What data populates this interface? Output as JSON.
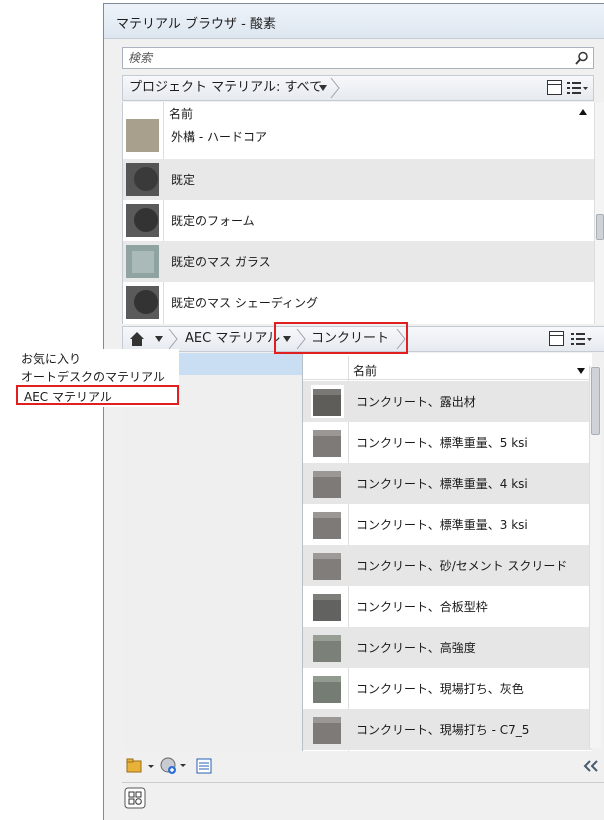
{
  "window": {
    "title": "マテリアル ブラウザ - 酸素"
  },
  "search": {
    "placeholder": "検索"
  },
  "project_bar": {
    "label": "プロジェクト マテリアル: すべて"
  },
  "upper_list": {
    "header": "名前",
    "items": [
      {
        "label": "外構 - ハードコア",
        "swatch": "#a89f8c"
      },
      {
        "label": "既定",
        "swatch": "#4a4a4a"
      },
      {
        "label": "既定のフォーム",
        "swatch": "#3e3e3e"
      },
      {
        "label": "既定のマス ガラス",
        "swatch": "#8fa3a0"
      },
      {
        "label": "既定のマス シェーディング",
        "swatch": "#3e3e3e"
      }
    ]
  },
  "library_bar": {
    "crumb_library": "AEC マテリアル",
    "crumb_category": "コンクリート"
  },
  "library_popup": {
    "items": [
      "お気に入り",
      "オートデスクのマテリアル",
      "AEC マテリアル"
    ],
    "selected_index": 2
  },
  "lower_list": {
    "header": "名前",
    "items": [
      {
        "label": "コンクリート、露出材",
        "swatch": "#6b6a66"
      },
      {
        "label": "コンクリート、標準重量、5 ksi",
        "swatch": "#8a8784"
      },
      {
        "label": "コンクリート、標準重量、4 ksi",
        "swatch": "#8a8784"
      },
      {
        "label": "コンクリート、標準重量、3 ksi",
        "swatch": "#8a8784"
      },
      {
        "label": "コンクリート、砂/セメント スクリード",
        "swatch": "#8c8985"
      },
      {
        "label": "コンクリート、合板型枠",
        "swatch": "#6e6f6a"
      },
      {
        "label": "コンクリート、高強度",
        "swatch": "#858b82"
      },
      {
        "label": "コンクリート、現場打ち、灰色",
        "swatch": "#7f867d"
      },
      {
        "label": "コンクリート、現場打ち - C7_5",
        "swatch": "#8a8784"
      }
    ]
  },
  "colors": {
    "highlight_red": "#e02020",
    "selection_blue": "#c9def3"
  }
}
